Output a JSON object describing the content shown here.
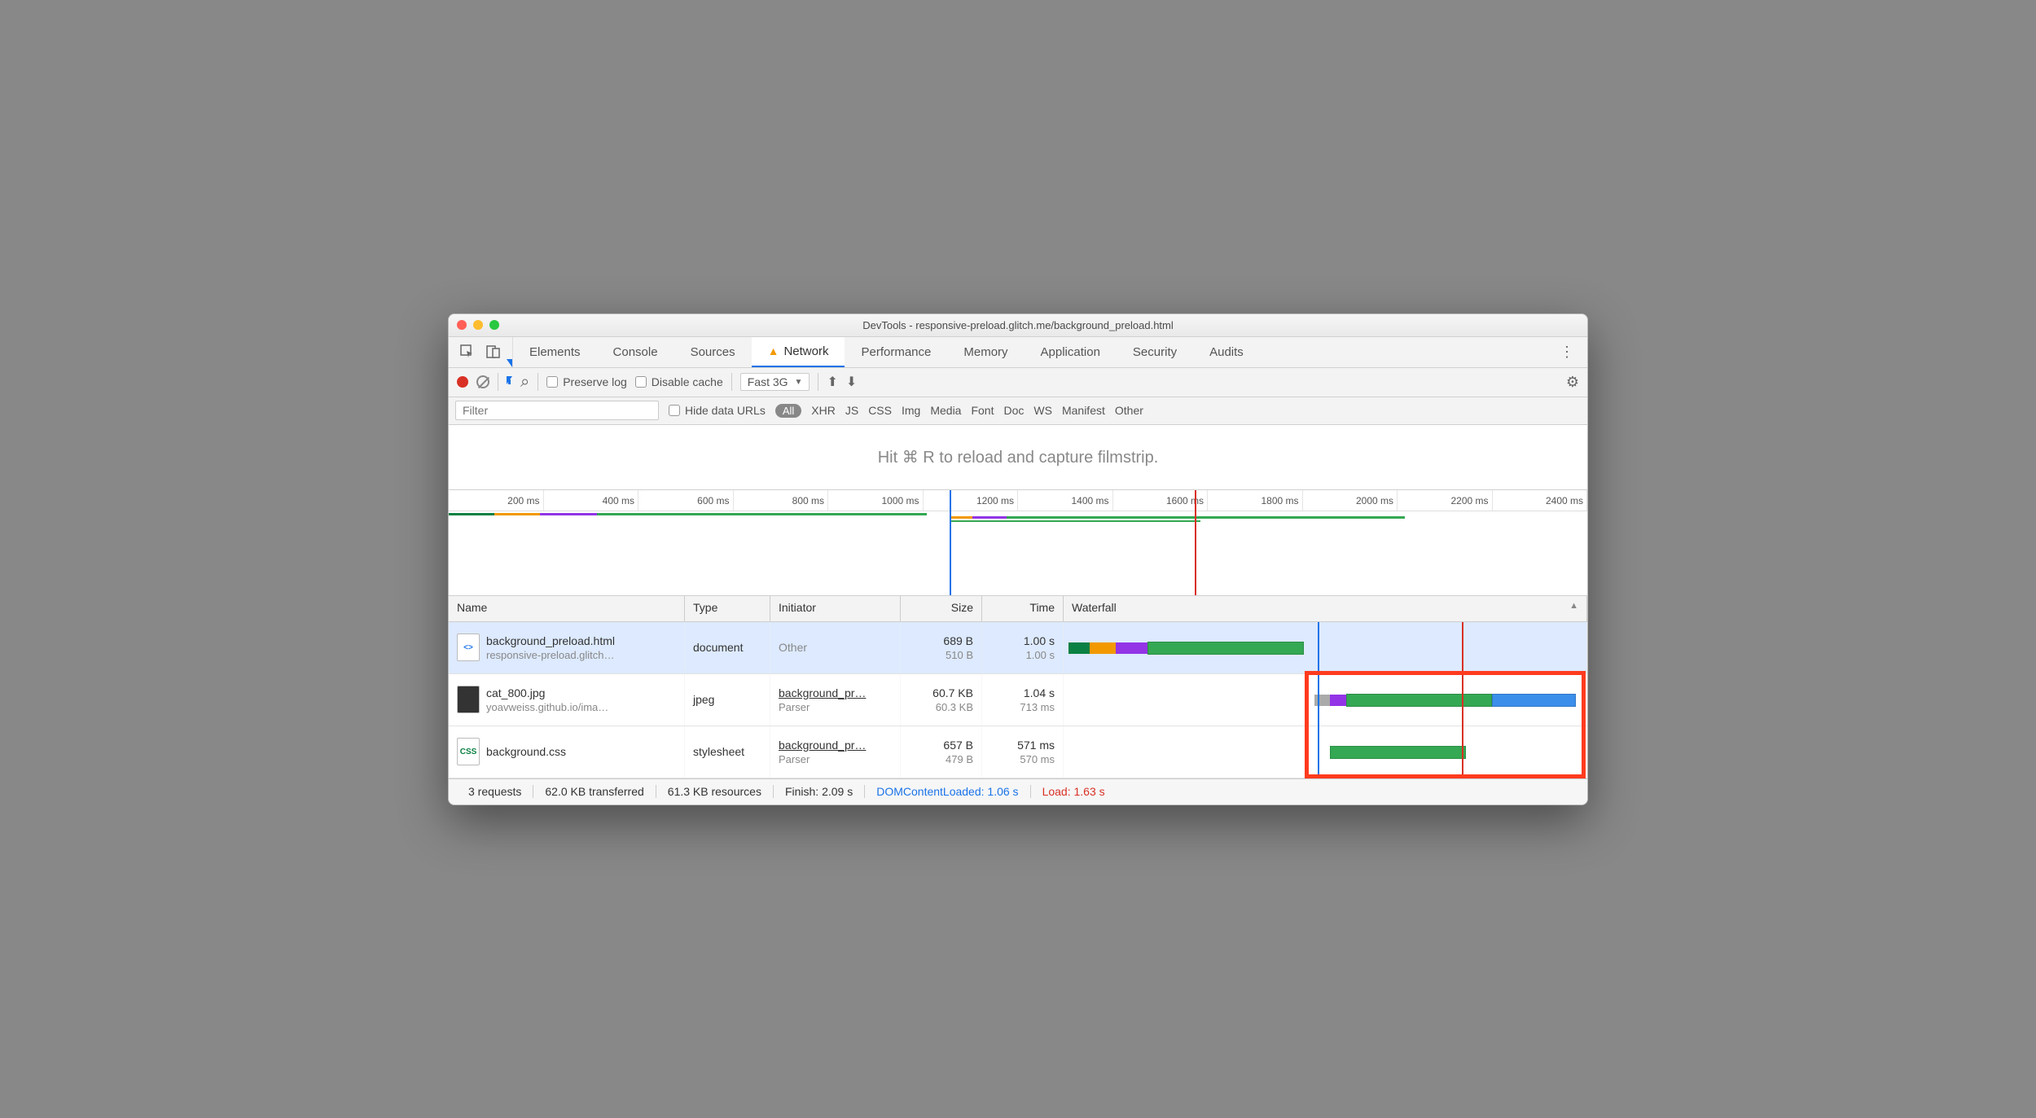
{
  "window": {
    "title": "DevTools - responsive-preload.glitch.me/background_preload.html"
  },
  "tabs": {
    "items": [
      "Elements",
      "Console",
      "Sources",
      "Network",
      "Performance",
      "Memory",
      "Application",
      "Security",
      "Audits"
    ],
    "active_index": 3
  },
  "toolbar": {
    "preserve_log": "Preserve log",
    "disable_cache": "Disable cache",
    "throttle": "Fast 3G"
  },
  "filterbar": {
    "placeholder": "Filter",
    "hide_data_urls": "Hide data URLs",
    "all": "All",
    "types": [
      "XHR",
      "JS",
      "CSS",
      "Img",
      "Media",
      "Font",
      "Doc",
      "WS",
      "Manifest",
      "Other"
    ]
  },
  "filmstrip_hint": "Hit ⌘ R to reload and capture filmstrip.",
  "timeline": {
    "ticks": [
      "200 ms",
      "400 ms",
      "600 ms",
      "800 ms",
      "1000 ms",
      "1200 ms",
      "1400 ms",
      "1600 ms",
      "1800 ms",
      "2000 ms",
      "2200 ms",
      "2400 ms"
    ]
  },
  "columns": {
    "name": "Name",
    "type": "Type",
    "initiator": "Initiator",
    "size": "Size",
    "time": "Time",
    "waterfall": "Waterfall"
  },
  "rows": [
    {
      "name": "background_preload.html",
      "sub": "responsive-preload.glitch…",
      "ico": "html",
      "type": "document",
      "initiator": "Other",
      "initiator_sub": "",
      "size": "689 B",
      "size_sub": "510 B",
      "time": "1.00 s",
      "time_sub": "1.00 s"
    },
    {
      "name": "cat_800.jpg",
      "sub": "yoavweiss.github.io/ima…",
      "ico": "img",
      "type": "jpeg",
      "initiator": "background_pr…",
      "initiator_sub": "Parser",
      "size": "60.7 KB",
      "size_sub": "60.3 KB",
      "time": "1.04 s",
      "time_sub": "713 ms"
    },
    {
      "name": "background.css",
      "sub": "",
      "ico": "css",
      "type": "stylesheet",
      "initiator": "background_pr…",
      "initiator_sub": "Parser",
      "size": "657 B",
      "size_sub": "479 B",
      "time": "571 ms",
      "time_sub": "570 ms"
    }
  ],
  "status": {
    "requests": "3 requests",
    "transferred": "62.0 KB transferred",
    "resources": "61.3 KB resources",
    "finish": "Finish: 2.09 s",
    "dcl": "DOMContentLoaded: 1.06 s",
    "load": "Load: 1.63 s"
  }
}
